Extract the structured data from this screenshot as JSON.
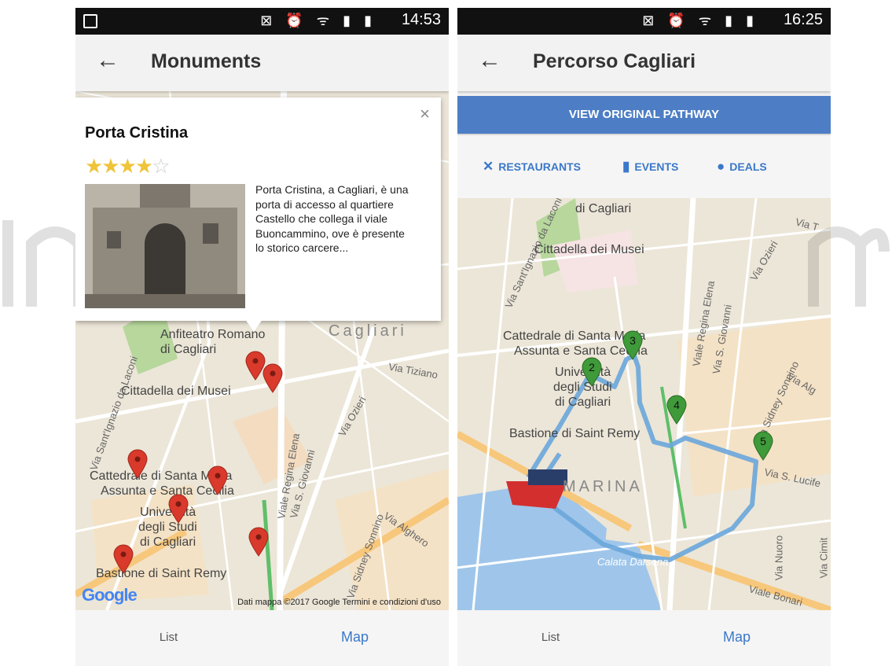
{
  "left_screen": {
    "status": {
      "time": "14:53",
      "icons": "⊠ ⏰ ᯤ ▮ ▮"
    },
    "title": "Monuments",
    "info_window": {
      "name": "Porta Cristina",
      "rating": 4,
      "stars_filled": "★★★★",
      "stars_empty": "☆",
      "close": "×",
      "description": "Porta Cristina, a Cagliari, è una porta di accesso al quartiere Castello che collega il viale Buoncammino, ove è presente lo storico carcere..."
    },
    "map": {
      "labels": {
        "anfiteatro": "Anfiteatro Romano",
        "anfiteatro2": "di Cagliari",
        "cagliari": "Cagliari",
        "tiziano": "Via Tiziano",
        "cittadella": "Cittadella dei Musei",
        "ozieri": "Via Ozieri",
        "santignazio": "Via Sant'Ignazio da Laconi",
        "cattedrale1": "Cattedrale di Santa Maria",
        "cattedrale2": "Assunta e Santa Cecilia",
        "regina": "Viale Regina Elena",
        "giovanni": "Via S. Giovanni",
        "universita1": "Università",
        "universita2": "degli Studi",
        "universita3": "di Cagliari",
        "alghero": "Via Alghero",
        "sonnino": "Via Sidney Sonnino",
        "bastione": "Bastione di Saint Remy"
      },
      "google": "Google",
      "attribution": "Dati mappa ©2017 Google   Termini e condizioni d'uso"
    },
    "nav": {
      "list": "List",
      "map": "Map"
    }
  },
  "right_screen": {
    "status": {
      "time": "16:25",
      "icons": "⊠ ⏰ ᯤ ▮ ▮"
    },
    "title": "Percorso Cagliari",
    "pathway_button": "VIEW ORIGINAL PATHWAY",
    "categories": [
      {
        "label": "RESTAURANTS",
        "icon": "fork-knife-icon",
        "glyph": "✕"
      },
      {
        "label": "EVENTS",
        "icon": "calendar-icon",
        "glyph": "▮"
      },
      {
        "label": "DEALS",
        "icon": "deals-icon",
        "glyph": "●"
      }
    ],
    "map": {
      "labels": {
        "cagliari": "di Cagliari",
        "viat": "Via T",
        "cittadella": "Cittadella dei Musei",
        "ozieri": "Via Ozieri",
        "santignazio": "Via Sant'Ignazio da Laconi",
        "regina": "Viale Regina Elena",
        "giovanni": "Via S. Giovanni",
        "cattedrale1": "Cattedrale di Santa Maria",
        "cattedrale2": "Assunta e Santa Cecilia",
        "universita1": "Università",
        "universita2": "degli Studi",
        "universita3": "di Cagliari",
        "sonnino": "Via Sidney Sonnino",
        "alg": "Via Alg",
        "bastione": "Bastione di Saint Remy",
        "lucifero": "Via S. Lucife",
        "marina": "MARINA",
        "nuoro": "Via Nuoro",
        "cimit": "Via Cimit",
        "darsena": "Calata Darsena",
        "bonaria": "Viale Bonari"
      },
      "route_stops": [
        "2",
        "3",
        "4",
        "5"
      ]
    },
    "nav": {
      "list": "List",
      "map": "Map"
    }
  },
  "colors": {
    "accent": "#3a78c9",
    "button": "#4d7ec5",
    "pin_red": "#d93a2b",
    "pin_green": "#3f9a3a",
    "route": "#6aa6dc",
    "map_bg": "#ece6d8",
    "water": "#9fc6ea",
    "park": "#b7d79c"
  }
}
